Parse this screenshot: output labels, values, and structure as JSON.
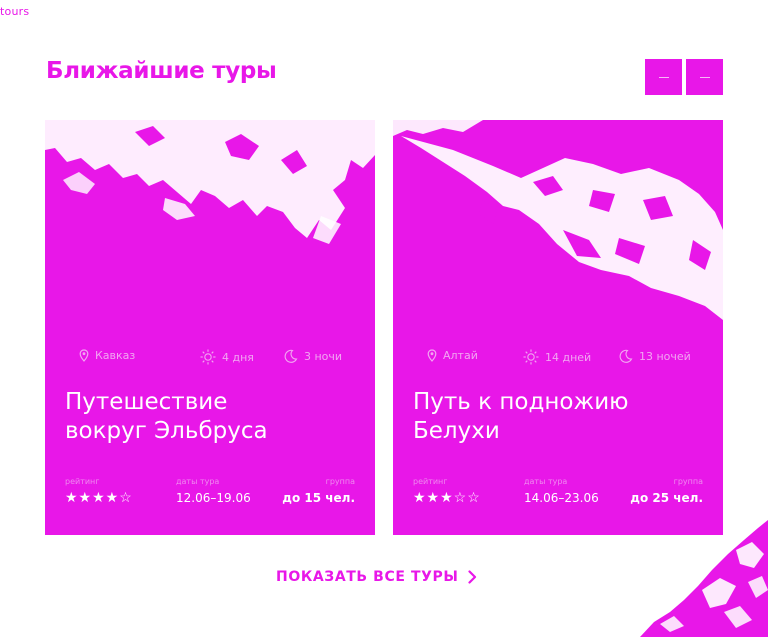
{
  "brand": {
    "logo": "tours"
  },
  "section": {
    "title": "Ближайшие туры",
    "prev_label": "—",
    "next_label": "—"
  },
  "colors": {
    "accent": "#e817e8",
    "text_on_accent": "#ffffff",
    "muted_on_accent": "#f2a6f2"
  },
  "cards": [
    {
      "location": "Кавказ",
      "days": "4 дня",
      "nights": "3 ночи",
      "title_line1": "Путешествие",
      "title_line2": "вокруг Эльбруса",
      "rating_label": "рейтинг",
      "stars": "★★★★☆",
      "rating": 4,
      "dates_label": "даты тура",
      "dates": "12.06–19.06",
      "group_label": "группа",
      "group": "до 15 чел."
    },
    {
      "location": "Алтай",
      "days": "14 дней",
      "nights": "13 ночей",
      "title_line1": "Путь к подножию",
      "title_line2": "Белухи",
      "rating_label": "рейтинг",
      "stars": "★★★☆☆",
      "rating": 3,
      "dates_label": "даты тура",
      "dates": "14.06–23.06",
      "group_label": "группа",
      "group": "до 25 чел."
    }
  ],
  "cta": {
    "show_all": "ПОКАЗАТЬ ВСЕ ТУРЫ",
    "icon": "chevron-right-icon"
  },
  "icons": {
    "location": "pin-icon",
    "days": "sun-icon",
    "nights": "moon-icon"
  }
}
